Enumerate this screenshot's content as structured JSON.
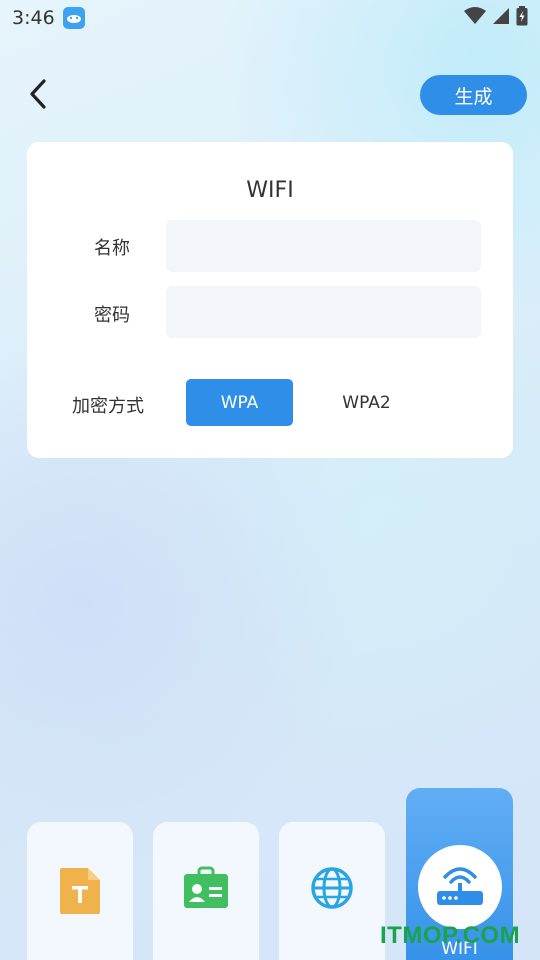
{
  "status_bar": {
    "time": "3:46",
    "icons": [
      "app-icon",
      "wifi-icon",
      "signal-icon",
      "battery-icon"
    ]
  },
  "header": {
    "back_icon": "chevron-left-icon",
    "generate_label": "生成"
  },
  "form": {
    "title": "WIFI",
    "name_label": "名称",
    "name_value": "",
    "password_label": "密码",
    "password_value": "",
    "encryption_label": "加密方式",
    "encryption_options": [
      "WPA",
      "WPA2"
    ],
    "encryption_selected": "WPA"
  },
  "types": [
    {
      "icon": "text-file-icon"
    },
    {
      "icon": "contact-card-icon"
    },
    {
      "icon": "globe-icon"
    },
    {
      "icon": "router-icon",
      "label": "WIFI",
      "active": true
    }
  ],
  "watermark": "ITMOP.COM",
  "colors": {
    "accent": "#2f8ee8",
    "input_bg": "#f2f6fa",
    "text_icon": "#f0b24a",
    "contact_icon": "#3fbf5f",
    "globe_icon": "#2aa5e0"
  }
}
